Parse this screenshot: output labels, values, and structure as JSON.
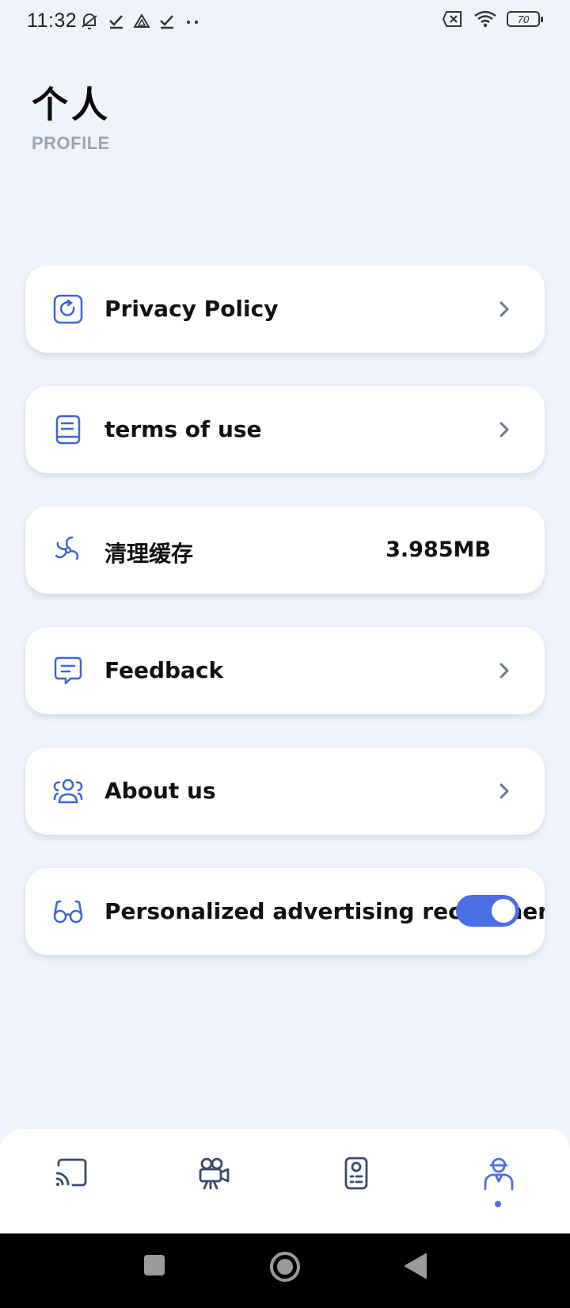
{
  "status_bar": {
    "time": "11:32",
    "battery": "70"
  },
  "header": {
    "title": "个人",
    "subtitle": "PROFILE"
  },
  "menu": {
    "privacy": {
      "label": "Privacy Policy",
      "icon": "privacy-icon"
    },
    "terms": {
      "label": "terms of use",
      "icon": "document-icon"
    },
    "cache": {
      "label": "清理缓存",
      "value": "3.985MB",
      "icon": "fan-icon"
    },
    "feedback": {
      "label": "Feedback",
      "icon": "chat-icon"
    },
    "about": {
      "label": "About us",
      "icon": "users-icon"
    },
    "ads": {
      "label": "Personalized advertising recommendation",
      "icon": "glasses-icon",
      "enabled": true
    }
  },
  "bottom_nav": {
    "items": [
      "cast-icon",
      "video-camera-icon",
      "remote-icon",
      "profile-person-icon"
    ],
    "active_index": 3
  },
  "colors": {
    "accent": "#4A6FE3",
    "background": "#F0F3FB",
    "icon": "#3B66D6"
  }
}
